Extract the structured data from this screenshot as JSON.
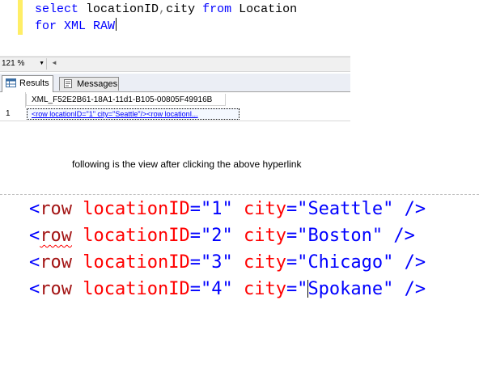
{
  "editor": {
    "line1": {
      "kw1": "select",
      "t1": " locationID",
      "op": ",",
      "t2": "city ",
      "kw2": "from",
      "t3": " Location"
    },
    "line2": {
      "kw1": "for",
      "t1": " ",
      "kw2": "XML RAW"
    }
  },
  "zoom": {
    "value": "121 %"
  },
  "tabs": {
    "results": "Results",
    "messages": "Messages"
  },
  "grid": {
    "column_header": "XML_F52E2B61-18A1-11d1-B105-00805F49916B",
    "rows": [
      {
        "num": "1",
        "value": "<row locationID=\"1\" city=\"Seattle\"/><row locationI..."
      }
    ]
  },
  "caption": "following is the view after clicking the above hyperlink",
  "xml": {
    "rows": [
      {
        "open": "<",
        "tag": "row",
        "attr1": "locationID",
        "eq1": "=\"",
        "val1": "1",
        "close1": "\"",
        "attr2": "city",
        "eq2": "=\"",
        "val2": "Seattle",
        "close2": "\"",
        "end": "/>"
      },
      {
        "open": "<",
        "tag": "row",
        "attr1": "locationID",
        "eq1": "=\"",
        "val1": "2",
        "close1": "\"",
        "attr2": "city",
        "eq2": "=\"",
        "val2": "Boston",
        "close2": "\"",
        "end": "/>"
      },
      {
        "open": "<",
        "tag": "row",
        "attr1": "locationID",
        "eq1": "=\"",
        "val1": "3",
        "close1": "\"",
        "attr2": "city",
        "eq2": "=\"",
        "val2": "Chicago",
        "close2": "\"",
        "end": "/>"
      },
      {
        "open": "<",
        "tag": "row",
        "attr1": "locationID",
        "eq1": "=\"",
        "val1": "4",
        "close1": "\"",
        "attr2": "city",
        "eq2": "=\"",
        "val2": "Spokane",
        "close2": "\"",
        "end": "/>"
      }
    ]
  },
  "colors": {
    "keyword": "#0000ff",
    "xml_tag": "#a31515",
    "xml_attr": "#ff0000",
    "xml_value": "#0000ff",
    "link": "#0000ff"
  }
}
